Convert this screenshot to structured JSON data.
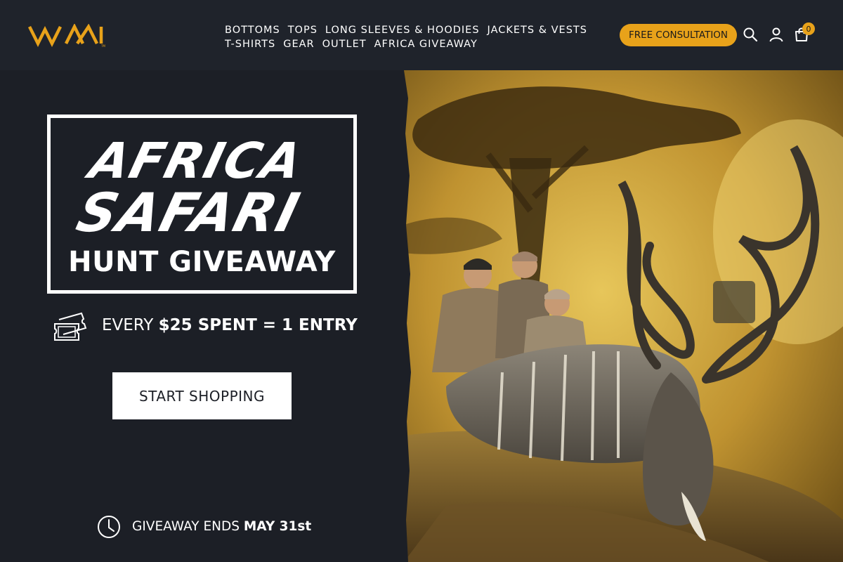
{
  "header": {
    "logo_alt": "VVAi",
    "nav_row1": [
      "BOTTOMS",
      "TOPS",
      "LONG SLEEVES & HOODIES",
      "JACKETS & VESTS"
    ],
    "nav_row2": [
      "T-SHIRTS",
      "GEAR",
      "OUTLET",
      "AFRICA GIVEAWAY"
    ],
    "consult_label": "FREE CONSULTATION",
    "search_icon": "search-icon",
    "account_icon": "user-icon",
    "cart_icon": "cart-icon",
    "cart_count": "0"
  },
  "promo": {
    "line1": "AFRICA",
    "line2": "SAFARI",
    "line3": "HUNT GIVEAWAY",
    "entry_prefix": "EVERY ",
    "entry_bold": "$25 SPENT = 1 ENTRY",
    "cta_label": "START SHOPPING",
    "ends_prefix": "GIVEAWAY ENDS ",
    "ends_bold": "MAY 31st"
  },
  "colors": {
    "header_bg": "#1f232b",
    "panel_bg": "#1c1f26",
    "accent": "#e8a21a",
    "white": "#ffffff"
  },
  "hero": {
    "subject": "three hunters posing with a kudu on the African savanna"
  }
}
